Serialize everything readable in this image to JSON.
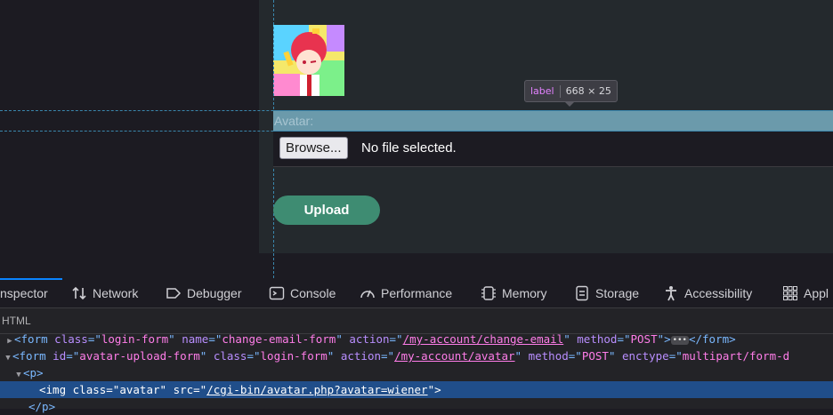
{
  "page": {
    "avatar_alt": "avatar",
    "highlight_label": "Avatar:",
    "tooltip": {
      "tag": "label",
      "dims": "668 × 25"
    },
    "browse_label": "Browse...",
    "file_status": "No file selected.",
    "upload_label": "Upload"
  },
  "devtools": {
    "tabs": [
      {
        "label": "nspector",
        "icon": "inspector-icon",
        "active": true
      },
      {
        "label": "Network",
        "icon": "network-icon"
      },
      {
        "label": "Debugger",
        "icon": "debugger-icon"
      },
      {
        "label": "Console",
        "icon": "console-icon"
      },
      {
        "label": "Performance",
        "icon": "performance-icon"
      },
      {
        "label": "Memory",
        "icon": "memory-icon"
      },
      {
        "label": "Storage",
        "icon": "storage-icon"
      },
      {
        "label": "Accessibility",
        "icon": "accessibility-icon"
      },
      {
        "label": "Appl",
        "icon": "application-icon"
      }
    ],
    "subpanel_label": "HTML",
    "tree": {
      "line1": {
        "tag_open": "<form",
        "a1": "class",
        "v1": "login-form",
        "a2": "name",
        "v2": "change-email-form",
        "a3": "action",
        "v3": "/my-account/change-email",
        "a4": "method",
        "v4": "POST",
        "close": "</form>"
      },
      "line2": {
        "tag_open": "<form",
        "a1": "id",
        "v1": "avatar-upload-form",
        "a2": "class",
        "v2": "login-form",
        "a3": "action",
        "v3": "/my-account/avatar",
        "a4": "method",
        "v4": "POST",
        "a5": "enctype",
        "v5": "multipart/form-d"
      },
      "line3": {
        "tag": "<p>"
      },
      "line4": {
        "tag_open": "<img",
        "a1": "class",
        "v1": "avatar",
        "a2": "src",
        "v2": "/cgi-bin/avatar.php?avatar=wiener",
        "tag_close": ">"
      },
      "line5": {
        "tag": "</p>"
      }
    }
  }
}
